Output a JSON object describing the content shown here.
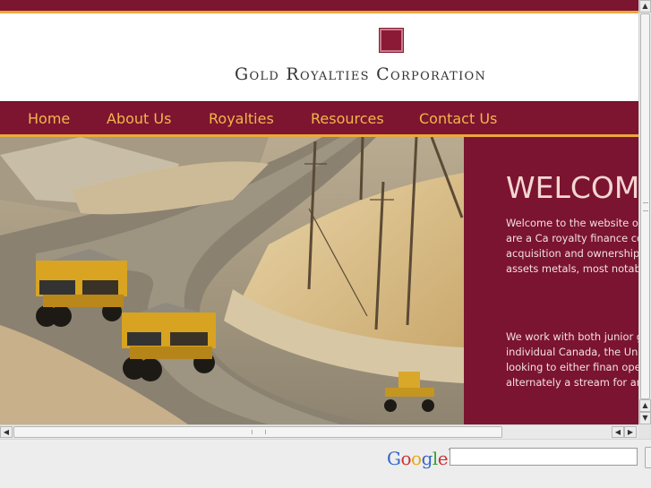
{
  "site": {
    "logo_text": "Gold Royalties Corporation"
  },
  "nav": {
    "items": [
      "Home",
      "About Us",
      "Royalties",
      "Resources",
      "Contact Us"
    ]
  },
  "welcome": {
    "title": "WELCOM",
    "paragraph1": "Welcome to the website o Corporation. We are a Ca royalty finance company s acquisition and ownership and metal stream assets metals, most notably gold",
    "paragraph2": "We work with both junior g companies and individual Canada, the United State are looking to either finan operation or alternately a stream for an upfront pay"
  },
  "toolbar": {
    "google_logo": "Google",
    "search_value": ""
  },
  "colors": {
    "brand_maroon": "#7c1530",
    "accent_gold": "#eba93a",
    "nav_text": "#f2b64a"
  }
}
